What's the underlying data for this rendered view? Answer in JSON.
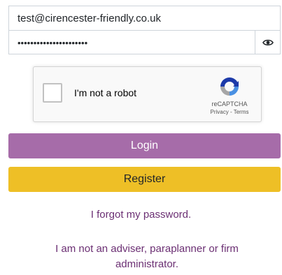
{
  "form": {
    "email_value": "test@cirencester-friendly.co.uk",
    "password_mask": "••••••••••••••••••••••",
    "show_password_icon": "eye-icon"
  },
  "captcha": {
    "label": "I'm not a robot",
    "brand": "reCAPTCHA",
    "privacy": "Privacy",
    "separator": " - ",
    "terms": "Terms",
    "logo_icon": "recaptcha-logo-icon"
  },
  "buttons": {
    "login_label": "Login",
    "register_label": "Register"
  },
  "links": {
    "forgot_password": "I forgot my password.",
    "not_adviser": "I am not an adviser, paraplanner or firm administrator."
  },
  "colors": {
    "login_bg": "#a66ca9",
    "register_bg": "#eebf26",
    "link": "#6b2f73"
  }
}
